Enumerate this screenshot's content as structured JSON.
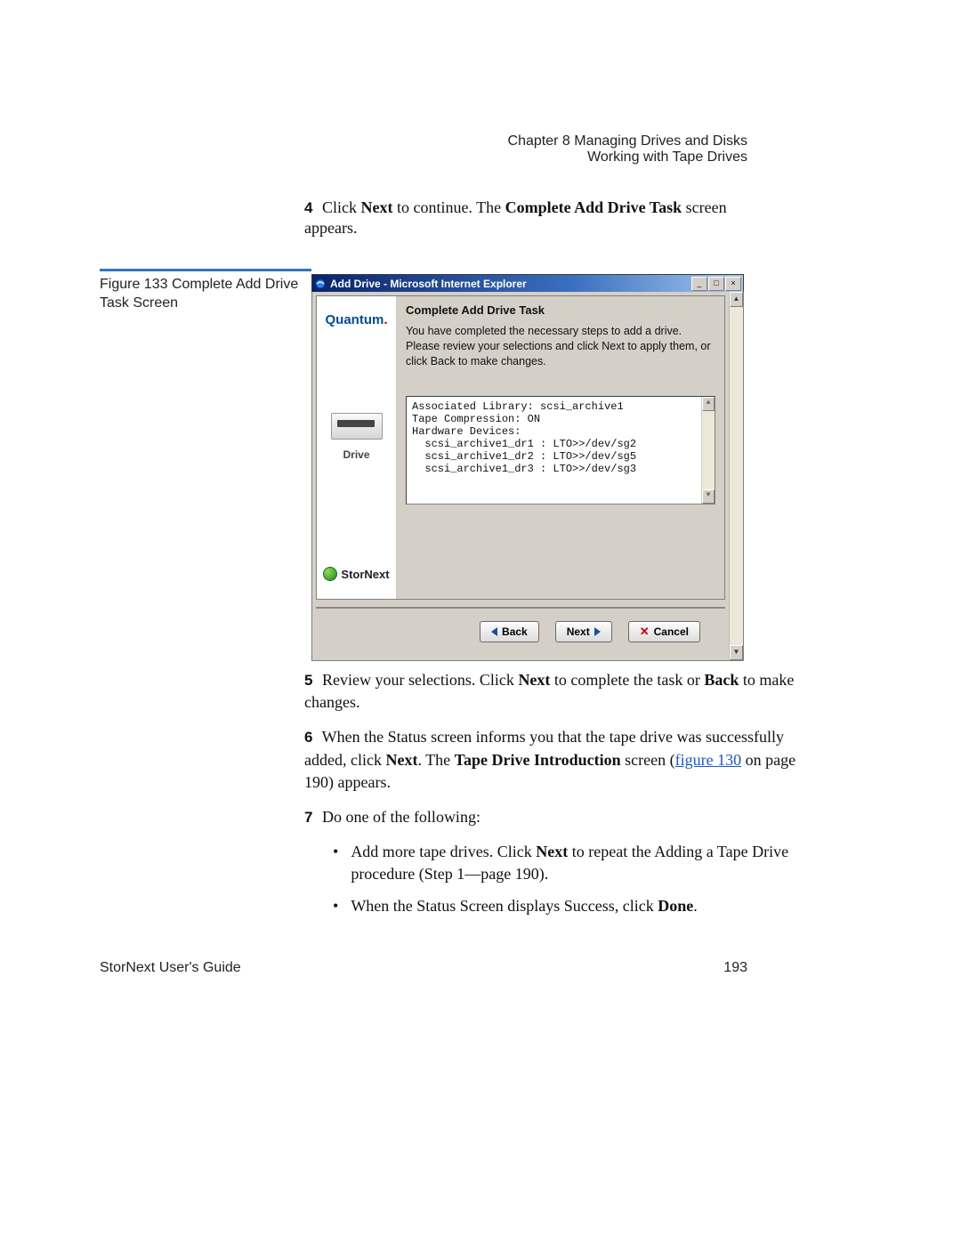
{
  "header": {
    "chapter": "Chapter 8  Managing Drives and Disks",
    "section": "Working with Tape Drives"
  },
  "step4": {
    "num": "4",
    "pre": "Click ",
    "next": "Next",
    "mid": " to continue. The ",
    "screen": "Complete Add Drive Task",
    "post": " screen appears."
  },
  "figure_caption": "Figure 133  Complete Add Drive Task Screen",
  "window": {
    "title": "Add Drive - Microsoft Internet Explorer",
    "minimize": "_",
    "maximize": "□",
    "close": "×",
    "sidebar": {
      "brand": "Quantum",
      "drive_label": "Drive",
      "product": "StorNext"
    },
    "task_title": "Complete Add Drive Task",
    "task_desc": "You have completed the necessary steps to add a drive. Please review your selections and click Next to apply them, or click Back to make changes.",
    "settings": "Associated Library: scsi_archive1\nTape Compression: ON\nHardware Devices:\n  scsi_archive1_dr1 : LTO>>/dev/sg2\n  scsi_archive1_dr2 : LTO>>/dev/sg5\n  scsi_archive1_dr3 : LTO>>/dev/sg3",
    "buttons": {
      "back": "Back",
      "next": "Next",
      "cancel": "Cancel"
    }
  },
  "step5": {
    "num": "5",
    "t1": "Review your selections. Click ",
    "next": "Next",
    "t2": " to complete the task or ",
    "back": "Back",
    "t3": " to make changes."
  },
  "step6": {
    "num": "6",
    "t1": "When the Status screen informs you that the tape drive was successfully added, click ",
    "next": "Next",
    "t2": ". The ",
    "screen": "Tape Drive Introduction",
    "t3": " screen (",
    "link": "figure 130",
    "t4": " on page 190) appears."
  },
  "step7": {
    "num": "7",
    "t1": "Do one of the following:",
    "bullet1_a": "Add more tape drives. Click ",
    "bullet1_next": "Next",
    "bullet1_b": " to repeat the Adding a Tape Drive procedure (Step 1—page 190).",
    "bullet2_a": "When the Status Screen displays Success, click ",
    "bullet2_done": "Done",
    "bullet2_b": "."
  },
  "footer": {
    "left": "StorNext User's Guide",
    "right": "193"
  }
}
